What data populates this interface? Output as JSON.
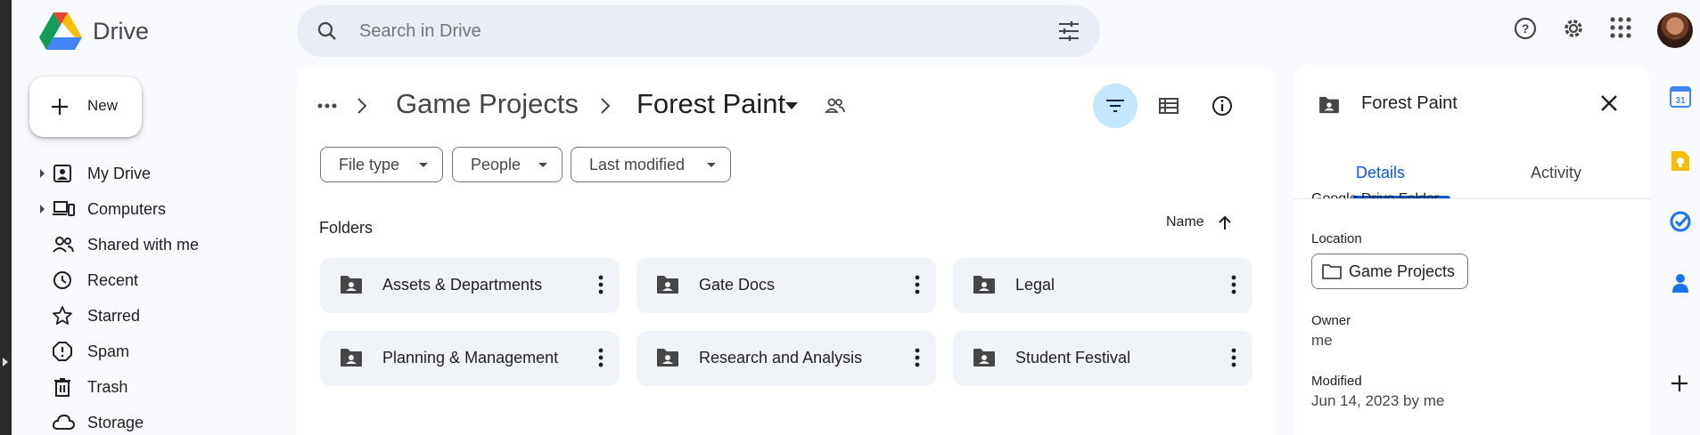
{
  "app": {
    "name": "Drive"
  },
  "search": {
    "placeholder": "Search in Drive"
  },
  "header_icons": [
    "help-icon",
    "settings-icon",
    "apps-grid-icon"
  ],
  "new_button": {
    "label": "New"
  },
  "nav": [
    {
      "label": "My Drive",
      "icon": "my-drive-icon",
      "expandable": true
    },
    {
      "label": "Computers",
      "icon": "computers-icon",
      "expandable": true
    },
    {
      "label": "Shared with me",
      "icon": "people-icon",
      "expandable": false
    },
    {
      "label": "Recent",
      "icon": "clock-icon",
      "expandable": false
    },
    {
      "label": "Starred",
      "icon": "star-icon",
      "expandable": false
    },
    {
      "label": "Spam",
      "icon": "spam-icon",
      "expandable": false
    },
    {
      "label": "Trash",
      "icon": "trash-icon",
      "expandable": false
    },
    {
      "label": "Storage",
      "icon": "cloud-icon",
      "expandable": false
    }
  ],
  "breadcrumb": {
    "parent": "Game Projects",
    "current": "Forest Paint"
  },
  "filters": {
    "file_type": "File type",
    "people": "People",
    "last_modified": "Last modified"
  },
  "folders_section": {
    "title": "Folders",
    "sort_label": "Name",
    "items": [
      "Assets & Departments",
      "Gate Docs",
      "Legal",
      "Planning & Management",
      "Research and Analysis",
      "Student Festival"
    ]
  },
  "details": {
    "title": "Forest Paint",
    "tabs": {
      "details": "Details",
      "activity": "Activity"
    },
    "active_tab": "Details",
    "type_value": "Google Drive Folder",
    "location_label": "Location",
    "location_value": "Game Projects",
    "owner_label": "Owner",
    "owner_value": "me",
    "modified_label": "Modified",
    "modified_value": "Jun 14, 2023 by me"
  },
  "colors": {
    "accent": "#0b57d0",
    "active_filter_bg": "#c2e7ff",
    "folder_bg": "#f0f4f9"
  }
}
